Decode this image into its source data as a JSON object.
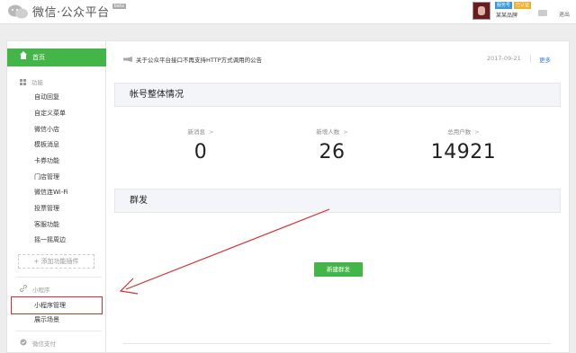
{
  "header": {
    "title": "微信·公众平台",
    "beta": "beta",
    "account_badges": [
      "服务号",
      "已认证"
    ],
    "account_name": "某某品牌",
    "logout": "退出"
  },
  "sidebar": {
    "home": "首页",
    "function_title": "功能",
    "function_items": [
      "自动回复",
      "自定义菜单",
      "微信小店",
      "模板消息",
      "卡券功能",
      "门店管理",
      "微信连Wi-Fi",
      "投票管理",
      "客服功能",
      "摇一摇周边"
    ],
    "add_plugin": "+ 添加功能插件",
    "miniprogram_title": "小程序",
    "miniprogram_items": [
      "小程序管理",
      "展示场景"
    ],
    "pay_title": "微信支付"
  },
  "notice": {
    "text": "关于公众平台接口不再支持HTTP方式调用的公告",
    "date": "2017-09-21",
    "more": "更多"
  },
  "overview": {
    "title": "帐号整体情况",
    "stats": [
      {
        "label": "新消息",
        "value": "0"
      },
      {
        "label": "新增人数",
        "value": "26"
      },
      {
        "label": "总用户数",
        "value": "14921"
      }
    ]
  },
  "broadcast": {
    "title": "群发",
    "button": "新建群发"
  },
  "colors": {
    "accent_green": "#44b549",
    "highlight_red": "#d62e2e",
    "link_blue": "#3f7ed8"
  }
}
